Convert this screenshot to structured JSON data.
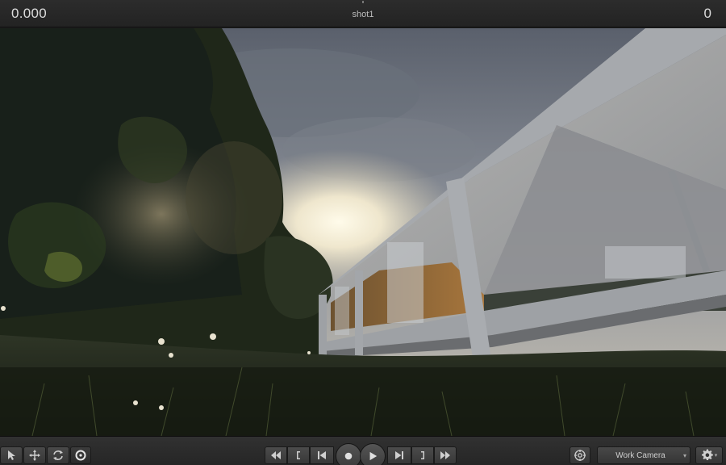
{
  "topbar": {
    "time": "0.000",
    "shot_name": "shot1",
    "frame": "0"
  },
  "viewport": {
    "scene": "viewport-render",
    "colors": {
      "sky_top": "#5f6673",
      "sky_sun": "#fbf3dc",
      "foliage_dark": "#1c2418",
      "grass": "#27301d",
      "slab": "#9a9ea4",
      "ceiling": "#aeb0b2"
    }
  },
  "toolbar": {
    "select_icon": "arrow-cursor-icon",
    "move_icon": "move-arrows-icon",
    "rotate_icon": "rotate-arrows-icon",
    "target_icon": "target-icon",
    "transport": {
      "rewind": "fast-rewind-icon",
      "prev_key": "bracket-left-icon",
      "to_start": "skip-start-icon",
      "record": "record-icon",
      "play": "play-icon",
      "to_end": "skip-end-icon",
      "next_key": "bracket-right-icon",
      "fast_forward": "fast-forward-icon"
    },
    "camera_icon": "camera-target-icon",
    "camera_select": "Work Camera",
    "settings_icon": "gear-icon"
  }
}
